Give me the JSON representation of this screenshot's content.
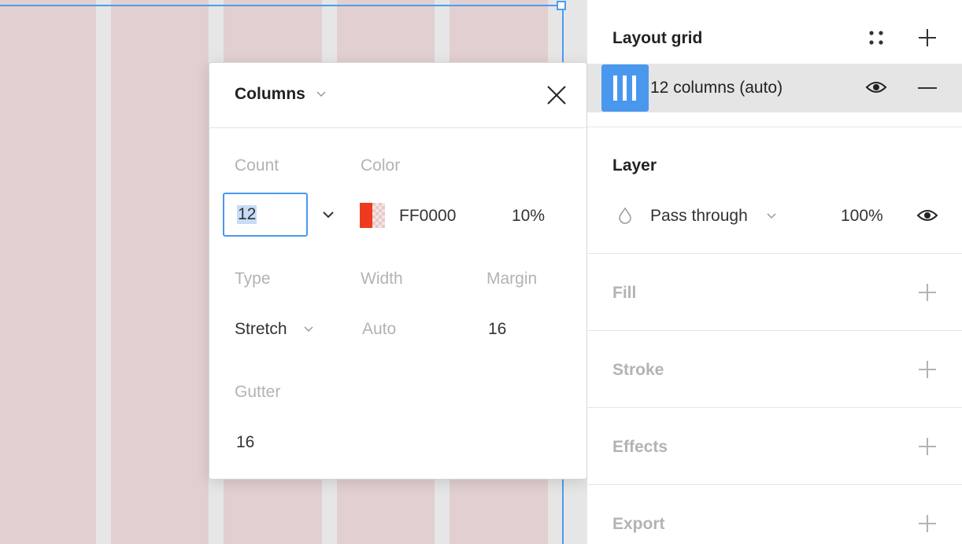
{
  "popover": {
    "title": "Columns",
    "count": {
      "label": "Count",
      "value": "12"
    },
    "color": {
      "label": "Color",
      "hex": "FF0000",
      "opacity": "10%",
      "swatch_color": "#ee3b1f"
    },
    "type": {
      "label": "Type",
      "value": "Stretch"
    },
    "width": {
      "label": "Width",
      "value": "Auto"
    },
    "margin": {
      "label": "Margin",
      "value": "16"
    },
    "gutter": {
      "label": "Gutter",
      "value": "16"
    }
  },
  "panel": {
    "layout_grid": {
      "title": "Layout grid",
      "item_label": "12 columns (auto)"
    },
    "layer": {
      "title": "Layer",
      "blend_mode": "Pass through",
      "opacity": "100%"
    },
    "fill": {
      "title": "Fill"
    },
    "stroke": {
      "title": "Stroke"
    },
    "effects": {
      "title": "Effects"
    },
    "export": {
      "title": "Export"
    }
  },
  "colors": {
    "accent": "#4a98ee",
    "column_fill": "#e2cfcf",
    "canvas": "#e6e6e6"
  }
}
